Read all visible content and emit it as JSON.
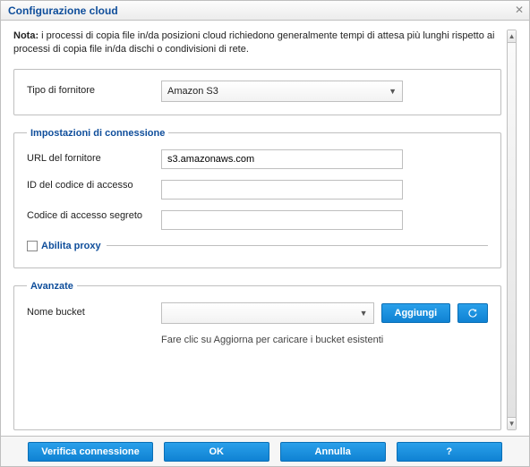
{
  "dialog": {
    "title": "Configurazione cloud",
    "note_label": "Nota:",
    "note_text": "i processi di copia file in/da posizioni cloud richiedono generalmente tempi di attesa più lunghi rispetto ai processi di copia file in/da dischi o condivisioni di rete."
  },
  "vendor": {
    "label": "Tipo di fornitore",
    "selected": "Amazon S3"
  },
  "connection": {
    "legend": "Impostazioni di connessione",
    "url_label": "URL del fornitore",
    "url_value": "s3.amazonaws.com",
    "access_id_label": "ID del codice di accesso",
    "access_id_value": "",
    "secret_label": "Codice di accesso segreto",
    "secret_value": "",
    "proxy_label": "Abilita proxy"
  },
  "advanced": {
    "legend": "Avanzate",
    "bucket_label": "Nome bucket",
    "bucket_selected": "",
    "add_label": "Aggiungi",
    "refresh_icon": "refresh-icon",
    "hint": "Fare clic su Aggiorna per caricare i bucket esistenti"
  },
  "footer": {
    "verify": "Verifica connessione",
    "ok": "OK",
    "cancel": "Annulla",
    "help": "?"
  }
}
